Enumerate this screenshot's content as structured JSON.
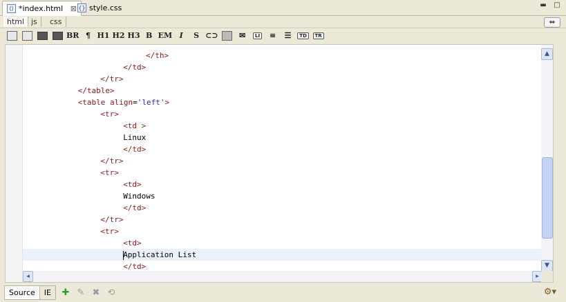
{
  "file_tabs": [
    {
      "label": "*index.html",
      "icon": "html-file-icon",
      "active": true
    },
    {
      "label": "style.css",
      "icon": "css-file-icon",
      "active": false
    }
  ],
  "mode_tabs": [
    "html",
    "js",
    "css"
  ],
  "toolbar": {
    "br": "BR",
    "para": "¶",
    "h1": "H1",
    "h2": "H2",
    "h3": "H3",
    "bold": "B",
    "em": "EM",
    "italic": "I",
    "strike": "S",
    "li": "LI",
    "td": "TD",
    "tr": "TR"
  },
  "code_lines": [
    {
      "indent": 20,
      "parts": [
        {
          "t": "</th>",
          "c": "tag"
        }
      ]
    },
    {
      "indent": 16,
      "parts": [
        {
          "t": "</td>",
          "c": "tag"
        }
      ]
    },
    {
      "indent": 12,
      "parts": [
        {
          "t": "</tr>",
          "c": "tag"
        }
      ]
    },
    {
      "indent": 8,
      "parts": [
        {
          "t": "</table>",
          "c": "tag"
        }
      ]
    },
    {
      "indent": 8,
      "parts": [
        {
          "t": "<table ",
          "c": "tag"
        },
        {
          "t": "align",
          "c": "attr"
        },
        {
          "t": "=",
          "c": "txt"
        },
        {
          "t": "'left'",
          "c": "val"
        },
        {
          "t": ">",
          "c": "tag"
        }
      ]
    },
    {
      "indent": 12,
      "parts": [
        {
          "t": "<tr>",
          "c": "tag"
        }
      ]
    },
    {
      "indent": 16,
      "parts": [
        {
          "t": "<td >",
          "c": "tag"
        }
      ]
    },
    {
      "indent": 16,
      "parts": [
        {
          "t": "Linux",
          "c": "txt"
        }
      ]
    },
    {
      "indent": 16,
      "parts": [
        {
          "t": "</td>",
          "c": "tag"
        }
      ]
    },
    {
      "indent": 12,
      "parts": [
        {
          "t": "</tr>",
          "c": "tag"
        }
      ]
    },
    {
      "indent": 12,
      "parts": [
        {
          "t": "<tr>",
          "c": "tag"
        }
      ]
    },
    {
      "indent": 16,
      "parts": [
        {
          "t": "<td>",
          "c": "tag"
        }
      ]
    },
    {
      "indent": 16,
      "parts": [
        {
          "t": "Windows",
          "c": "txt"
        }
      ]
    },
    {
      "indent": 16,
      "parts": [
        {
          "t": "</td>",
          "c": "tag"
        }
      ]
    },
    {
      "indent": 12,
      "parts": [
        {
          "t": "</tr>",
          "c": "tag"
        }
      ]
    },
    {
      "indent": 12,
      "parts": [
        {
          "t": "<tr>",
          "c": "tag"
        }
      ]
    },
    {
      "indent": 16,
      "parts": [
        {
          "t": "<td>",
          "c": "tag"
        }
      ]
    },
    {
      "indent": 16,
      "parts": [
        {
          "t": "Application List",
          "c": "txt"
        }
      ],
      "current": true
    },
    {
      "indent": 16,
      "parts": [
        {
          "t": "</td>",
          "c": "tag"
        }
      ]
    }
  ],
  "bottom_tabs": [
    "Source",
    "IE"
  ],
  "colors": {
    "tag": "#8b1a1a",
    "attr": "#8b1a1a",
    "val": "#2b2bb0",
    "txt": "#000000",
    "current_line": "#eaf1fb"
  }
}
